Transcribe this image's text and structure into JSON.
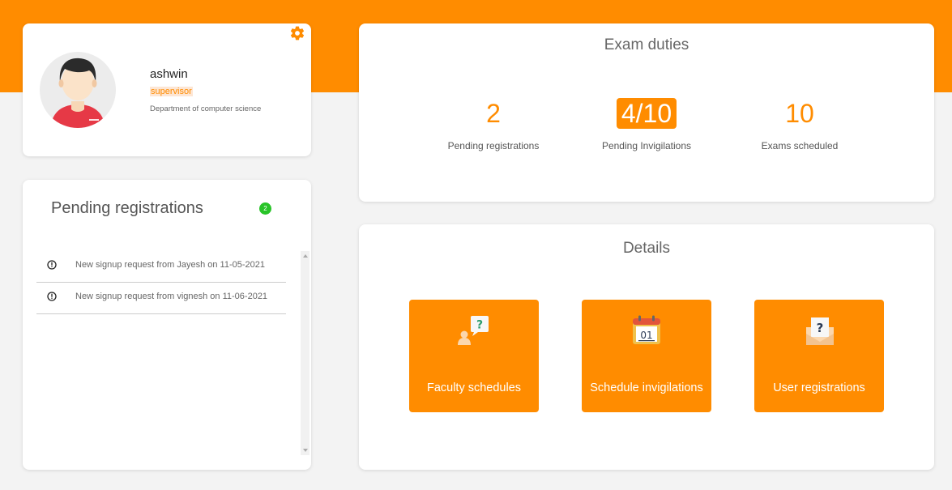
{
  "colors": {
    "accent": "#ff8c00",
    "badge": "#28c428"
  },
  "profile": {
    "name": "ashwin",
    "role": "supervisor",
    "department": "Department of computer science",
    "settings_icon": "gear-icon",
    "avatar_icon": "user-avatar"
  },
  "pending": {
    "title": "Pending registrations",
    "count": "2",
    "items": [
      {
        "icon": "info-icon",
        "text": "New signup request from Jayesh on 11-05-2021"
      },
      {
        "icon": "info-icon",
        "text": "New signup request from vignesh on 11-06-2021"
      }
    ]
  },
  "exam_duties": {
    "title": "Exam duties",
    "stats": [
      {
        "value": "2",
        "label": "Pending registrations"
      },
      {
        "value": "4/10",
        "label": "Pending Invigilations"
      },
      {
        "value": "10",
        "label": "Exams scheduled"
      }
    ]
  },
  "details": {
    "title": "Details",
    "tiles": [
      {
        "icon": "person-question-icon",
        "label": "Faculty schedules"
      },
      {
        "icon": "calendar-icon",
        "label": "Schedule invigilations"
      },
      {
        "icon": "envelope-question-icon",
        "label": "User registrations"
      }
    ]
  }
}
